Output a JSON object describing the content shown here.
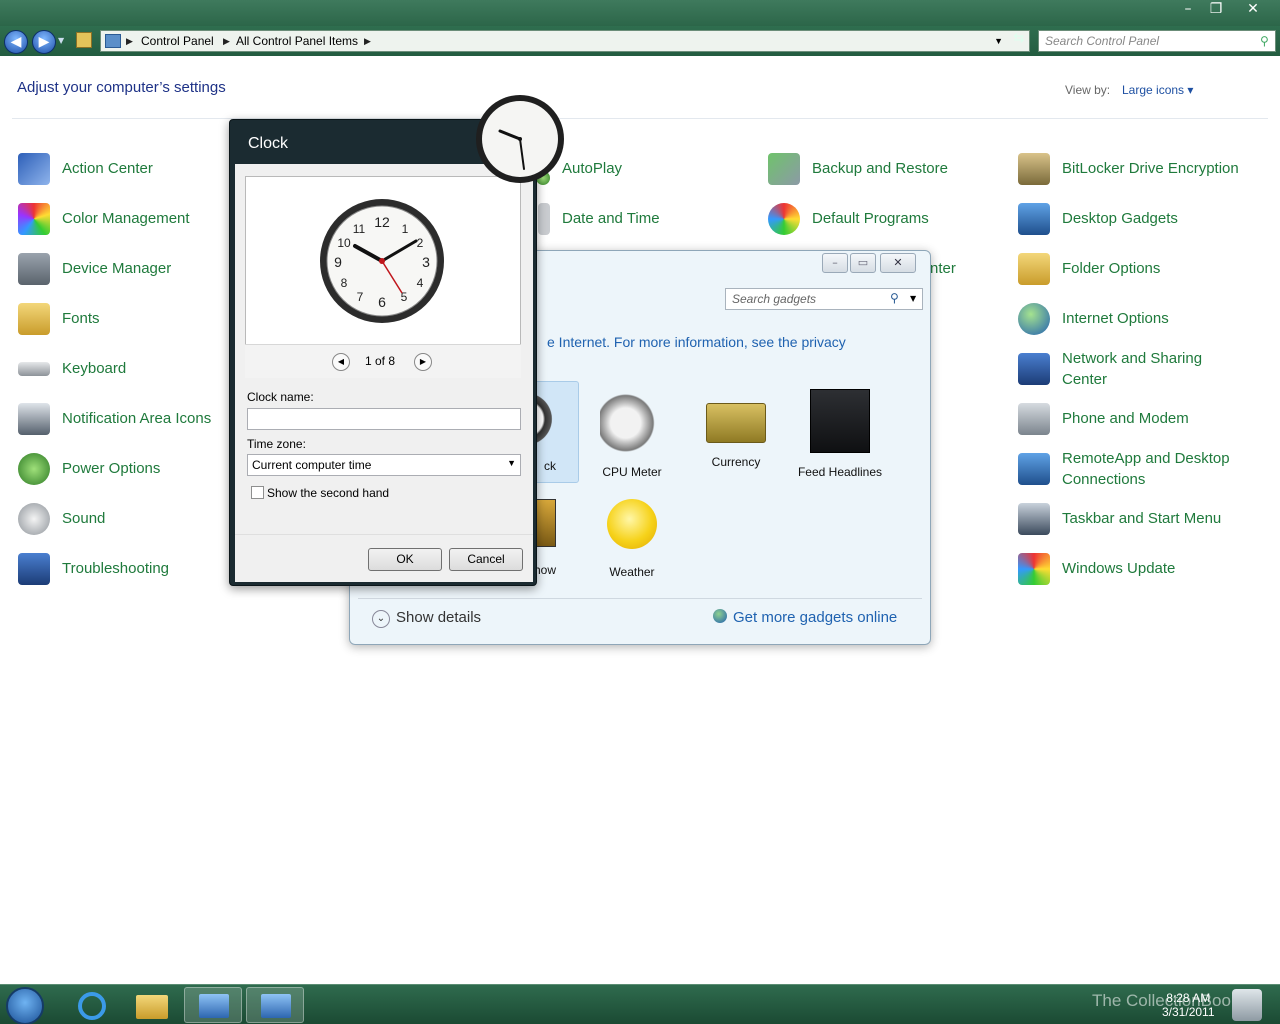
{
  "window": {
    "minimize": "–",
    "maximize": "❐",
    "close": "✕"
  },
  "address": {
    "back": "◀",
    "forward": "▶",
    "segments": [
      "Control Panel",
      "All Control Panel Items"
    ],
    "search_placeholder": "Search Control Panel"
  },
  "header": {
    "title": "Adjust your computer’s settings",
    "view_by_label": "View by:",
    "view_by_value": "Large icons ▾"
  },
  "items": {
    "col1": [
      "Action Center",
      "Color Management",
      "Device Manager",
      "Fonts",
      "Keyboard",
      "Notification Area Icons",
      "Power Options",
      "Sound",
      "Troubleshooting"
    ],
    "col2": [
      "AutoPlay",
      "Date and Time"
    ],
    "col3": [
      "Backup and Restore",
      "Default Programs",
      "nter"
    ],
    "col4": [
      "BitLocker Drive Encryption",
      "Desktop Gadgets",
      "Folder Options",
      "Internet Options",
      "Network and Sharing Center",
      "Phone and Modem",
      "RemoteApp and Desktop Connections",
      "Taskbar and Start Menu",
      "Windows Update"
    ]
  },
  "gallery": {
    "search_placeholder": "Search gadgets",
    "info_text": "e Internet.  For more information, see the privacy",
    "gadgets": [
      "ck",
      "CPU Meter",
      "Currency",
      "Feed Headlines",
      "how",
      "Weather"
    ],
    "show_details": "Show details",
    "get_more": "Get more gadgets online"
  },
  "clock_dialog": {
    "title": "Clock",
    "pager_text": "1 of 8",
    "clock_name_label": "Clock name:",
    "clock_name_value": "",
    "time_zone_label": "Time zone:",
    "time_zone_value": "Current computer time",
    "second_hand_label": "Show the second hand",
    "second_hand_checked": false,
    "ok": "OK",
    "cancel": "Cancel"
  },
  "taskbar": {
    "time": "8:28 AM",
    "date": "3/31/2011",
    "watermark": "The CollectionBook"
  },
  "colors": {
    "link_green": "#1f7a3c",
    "title_blue": "#1e3287",
    "link_blue": "#1f62b0",
    "chrome_green": "#2c6649"
  }
}
